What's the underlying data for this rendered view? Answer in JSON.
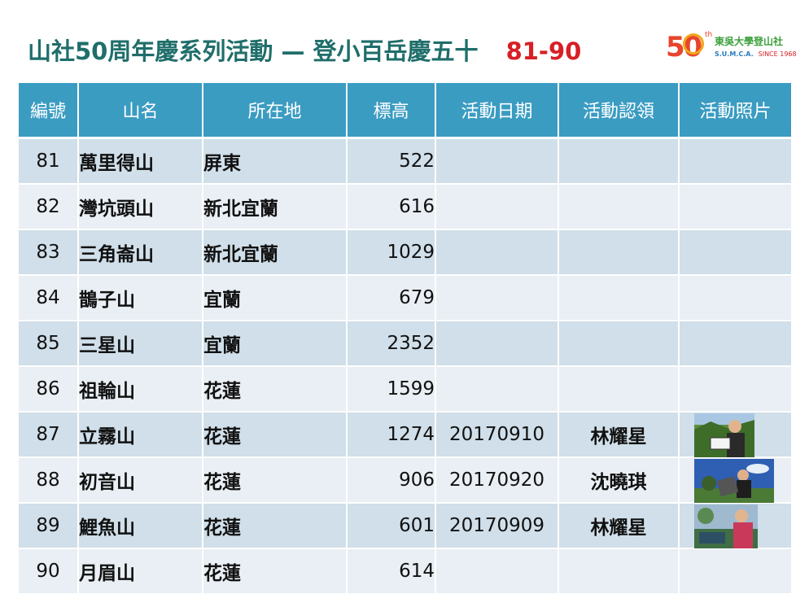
{
  "title": {
    "main": "山社50周年慶系列活動 — 登小百岳慶五十",
    "range": "81-90"
  },
  "logo": {
    "numeral": "50",
    "superscript": "th",
    "chinese": "東吳大學登山社",
    "english": "S.U.M.C.A.",
    "since": "SINCE 1968"
  },
  "table": {
    "headers": [
      "編號",
      "山名",
      "所在地",
      "標高",
      "活動日期",
      "活動認領",
      "活動照片"
    ],
    "rows": [
      {
        "no": "81",
        "name": "萬里得山",
        "location": "屏東",
        "height": "522",
        "date": "",
        "claimer": "",
        "photo": false
      },
      {
        "no": "82",
        "name": "灣坑頭山",
        "location": "新北宜蘭",
        "height": "616",
        "date": "",
        "claimer": "",
        "photo": false
      },
      {
        "no": "83",
        "name": "三角崙山",
        "location": "新北宜蘭",
        "height": "1029",
        "date": "",
        "claimer": "",
        "photo": false
      },
      {
        "no": "84",
        "name": "鵲子山",
        "location": "宜蘭",
        "height": "679",
        "date": "",
        "claimer": "",
        "photo": false
      },
      {
        "no": "85",
        "name": "三星山",
        "location": "宜蘭",
        "height": "2352",
        "date": "",
        "claimer": "",
        "photo": false
      },
      {
        "no": "86",
        "name": "祖輪山",
        "location": "花蓮",
        "height": "1599",
        "date": "",
        "claimer": "",
        "photo": false
      },
      {
        "no": "87",
        "name": "立霧山",
        "location": "花蓮",
        "height": "1274",
        "date": "20170910",
        "claimer": "林耀星",
        "photo": true
      },
      {
        "no": "88",
        "name": "初音山",
        "location": "花蓮",
        "height": "906",
        "date": "20170920",
        "claimer": "沈曉琪",
        "photo": true
      },
      {
        "no": "89",
        "name": "鯉魚山",
        "location": "花蓮",
        "height": "601",
        "date": "20170909",
        "claimer": "林耀星",
        "photo": true
      },
      {
        "no": "90",
        "name": "月眉山",
        "location": "花蓮",
        "height": "614",
        "date": "",
        "claimer": "",
        "photo": false
      }
    ]
  }
}
